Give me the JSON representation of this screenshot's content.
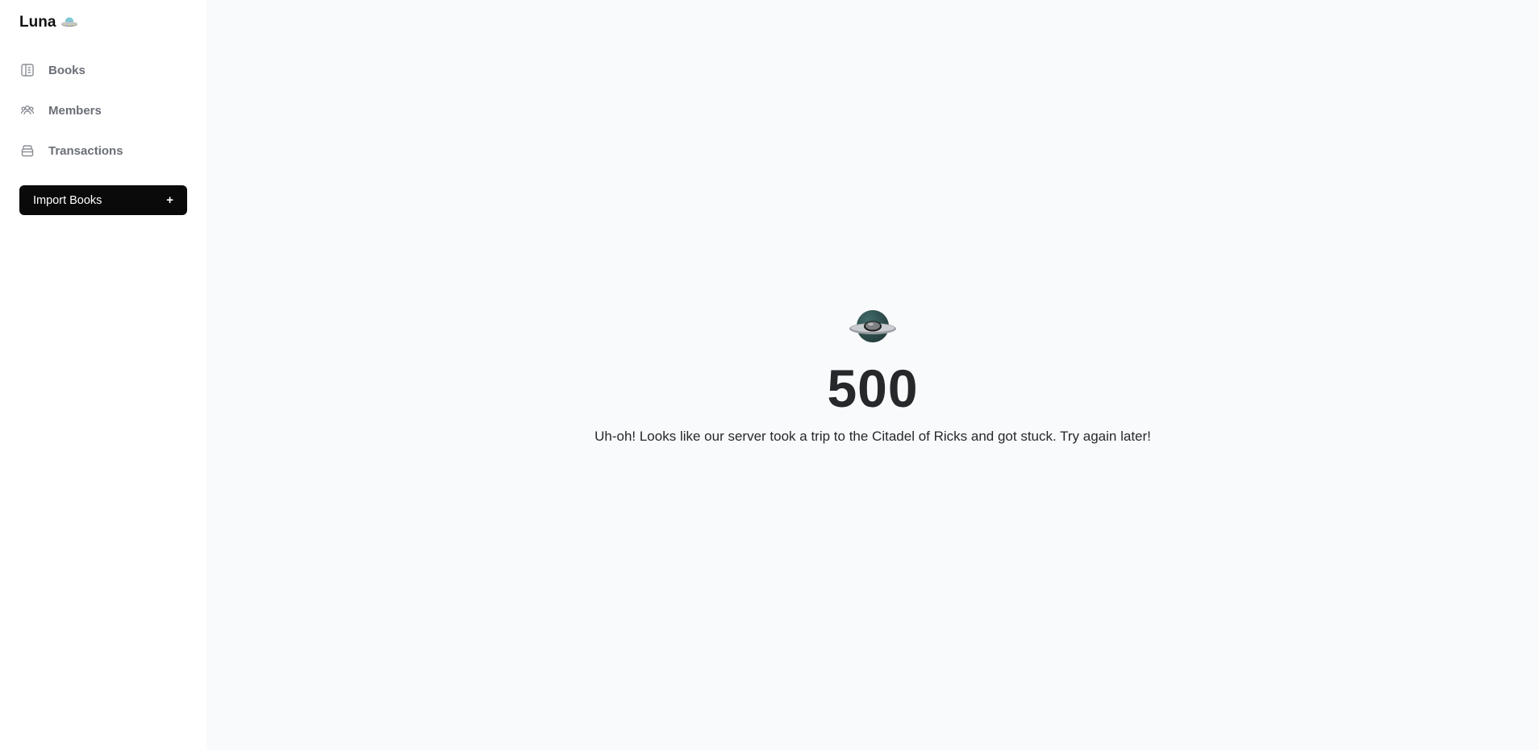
{
  "sidebar": {
    "brand": "Luna",
    "brand_icon": "ufo-icon",
    "items": [
      {
        "label": "Books",
        "icon": "book-icon"
      },
      {
        "label": "Members",
        "icon": "members-icon"
      },
      {
        "label": "Transactions",
        "icon": "archive-icon"
      }
    ],
    "import_button": {
      "label": "Import Books",
      "icon": "+"
    }
  },
  "error": {
    "icon": "planet-icon",
    "code": "500",
    "message": "Uh-oh! Looks like our server took a trip to the Citadel of Ricks and got stuck. Try again later!"
  },
  "colors": {
    "background": "#f9fafb",
    "sidebar": "#ffffff",
    "button": "#0a0a0a",
    "nav_text": "#6b6f76",
    "heading": "#26282c"
  }
}
